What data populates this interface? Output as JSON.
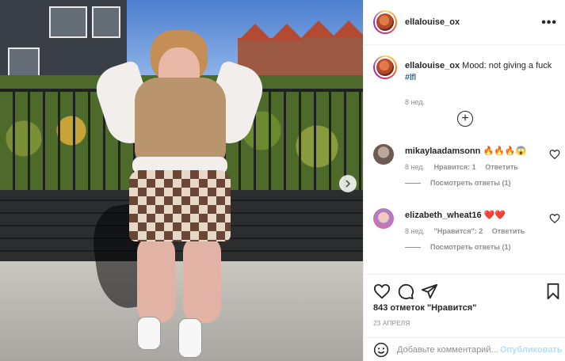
{
  "post": {
    "username": "ellalouise_ox"
  },
  "caption": {
    "username": "ellalouise_ox",
    "text": "Mood: not giving a fuck",
    "hashtag": "#lfl",
    "age": "8 нед."
  },
  "comments": [
    {
      "username": "mikaylaadamsonn",
      "text": "🔥🔥🔥😱",
      "age": "8 нед.",
      "likes": "Нравится: 1",
      "reply": "Ответить",
      "view_replies": "Посмотреть ответы (1)"
    },
    {
      "username": "elizabeth_wheat16",
      "text": "❤️❤️",
      "age": "8 нед.",
      "likes": "\"Нравится\": 2",
      "reply": "Ответить",
      "view_replies": "Посмотреть ответы (1)"
    }
  ],
  "actions": {
    "likes": "843 отметок \"Нравится\"",
    "date": "23 АПРЕЛЯ"
  },
  "add_comment": {
    "placeholder": "Добавьте комментарий...",
    "publish": "Опубликовать"
  },
  "icons": {
    "more": "more-options-icon",
    "load_more": "plus-circle-icon",
    "like": "heart-icon",
    "comment": "comment-bubble-icon",
    "share": "paper-plane-icon",
    "save": "bookmark-icon",
    "emoji": "smiley-icon",
    "next": "chevron-right-icon"
  },
  "colors": {
    "text": "#262626",
    "secondary": "#8e8e8e",
    "link": "#00376b",
    "publish_disabled": "#b2dffc",
    "border": "#efefef"
  }
}
